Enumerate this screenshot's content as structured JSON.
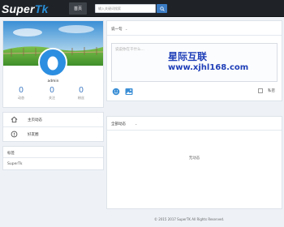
{
  "header": {
    "logo_part1": "Super",
    "logo_part2": "Tk",
    "nav_home": "首页",
    "search_placeholder": "输入关键词搜索",
    "search_icon": "search-icon"
  },
  "profile": {
    "username": "admin",
    "stats": [
      {
        "value": "0",
        "label": "动态"
      },
      {
        "value": "0",
        "label": "关注"
      },
      {
        "value": "0",
        "label": "粉丝"
      }
    ]
  },
  "menu": {
    "items": [
      {
        "label": "主页动态",
        "icon": "home-icon"
      },
      {
        "label": "好友圈",
        "icon": "friends-icon"
      }
    ]
  },
  "tags": {
    "heading": "标签",
    "items": [
      "SuperTk"
    ]
  },
  "post": {
    "heading": "说一句",
    "placeholder": "说说你在干什么...",
    "privacy_label": "私密",
    "tools": [
      "emoji-icon",
      "image-icon"
    ]
  },
  "watermark": {
    "line1": "星际互联",
    "line2": "www.xjhl168.com"
  },
  "feed": {
    "heading": "全部动态",
    "empty": "无动态"
  },
  "footer": {
    "text": "© 2015 2017 SuperTK All Rights Reserved."
  },
  "colors": {
    "topbar": "#1f2328",
    "accent": "#2a8fd8",
    "watermark": "#1f3fb8"
  }
}
